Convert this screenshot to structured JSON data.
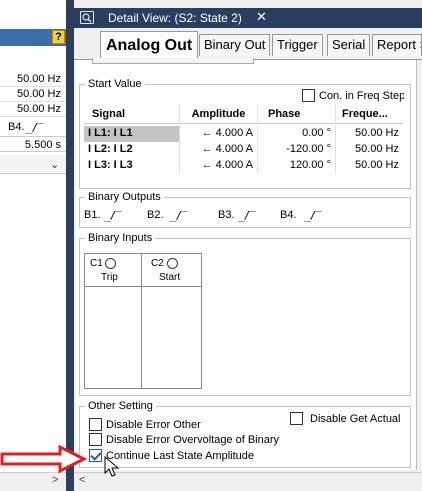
{
  "left_pane": {
    "help_icon": "?",
    "freq_rows": [
      "50.00 Hz",
      "50.00 Hz",
      "50.00 Hz"
    ],
    "b4_label": "B4.",
    "time_value": "5.500 s"
  },
  "window": {
    "title": "Detail View: (S2: State 2)",
    "close": "✕"
  },
  "tabs": [
    {
      "label": "Analog Out",
      "active": true
    },
    {
      "label": "Binary Out"
    },
    {
      "label": "Trigger"
    },
    {
      "label": "Serial"
    },
    {
      "label": "Report S"
    }
  ],
  "start_value": {
    "legend": "Start Value",
    "freq_step_label": "Con. in Freq Step",
    "freq_step_checked": false,
    "columns": [
      "Signal",
      "Amplitude",
      "Phase",
      "Freque..."
    ],
    "rows": [
      {
        "signal": "I L1: I L1",
        "amplitude": "← 4.000 A",
        "phase": "0.00 °",
        "freq": "50.00 Hz"
      },
      {
        "signal": "I L2: I L2",
        "amplitude": "← 4.000 A",
        "phase": "-120.00 °",
        "freq": "50.00 Hz"
      },
      {
        "signal": "I L3: I L3",
        "amplitude": "← 4.000 A",
        "phase": "120.00 °",
        "freq": "50.00 Hz"
      }
    ]
  },
  "binary_outputs": {
    "legend": "Binary Outputs",
    "items": [
      "B1.",
      "B2.",
      "B3.",
      "B4."
    ]
  },
  "binary_inputs": {
    "legend": "Binary Inputs",
    "items": [
      {
        "id": "C1",
        "label": "Trip"
      },
      {
        "id": "C2",
        "label": "Start"
      }
    ]
  },
  "other_setting": {
    "legend": "Other Setting",
    "disable_error_other": "Disable Error Other",
    "disable_error_overvoltage": "Disable Error Overvoltage of Binary",
    "continue_last_state": "Continue Last State Amplitude",
    "disable_get_actual": "Disable Get Actual",
    "continue_last_state_checked": true
  },
  "colors": {
    "title_bar": "#2a3f5f",
    "accent_checkbox": "#1b5fb0",
    "annotation_arrow": "#e02020"
  }
}
